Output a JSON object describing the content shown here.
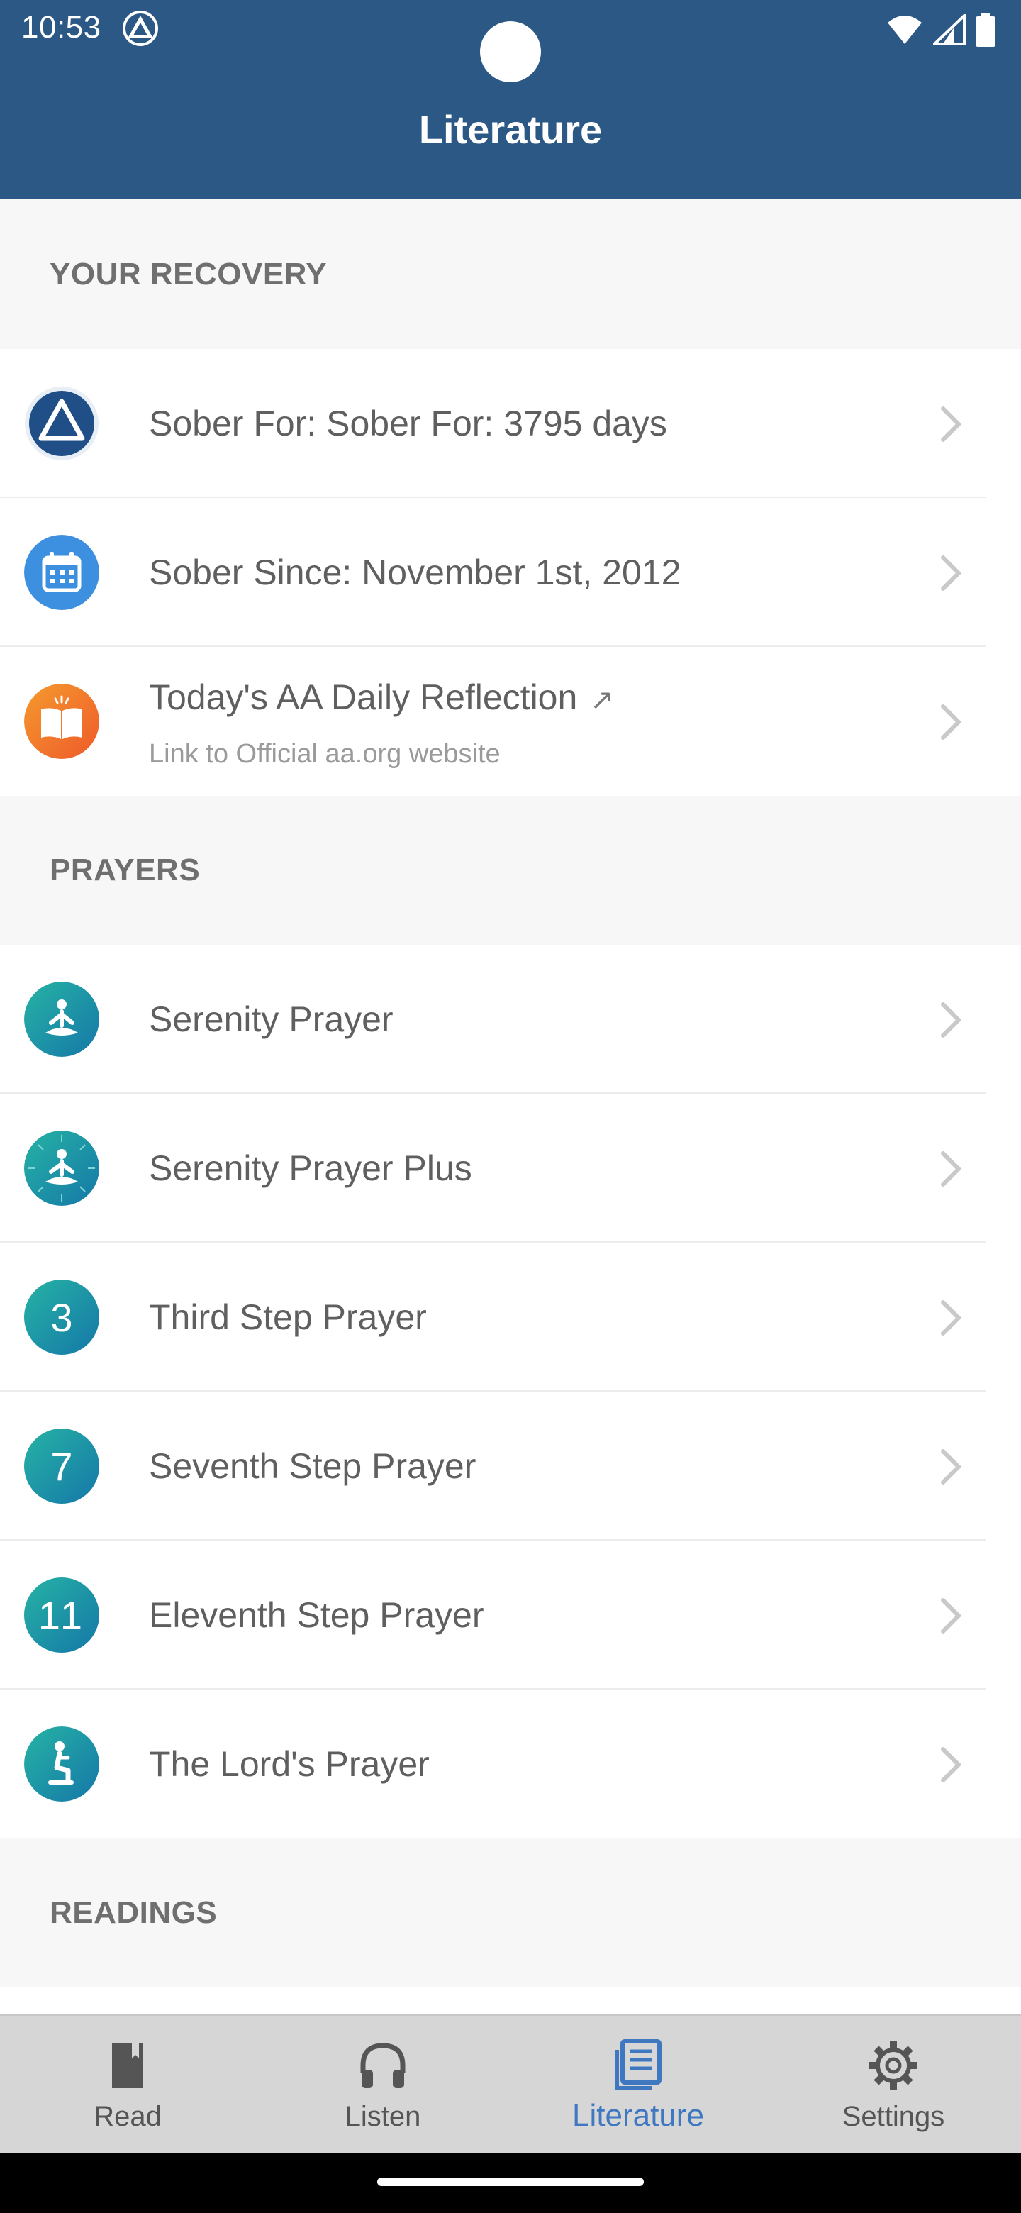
{
  "status_bar": {
    "time": "10:53"
  },
  "app_bar": {
    "title": "Literature"
  },
  "sections": {
    "recovery": {
      "header": "YOUR RECOVERY"
    },
    "prayers": {
      "header": "PRAYERS"
    },
    "readings": {
      "header": "READINGS"
    }
  },
  "recovery_items": [
    {
      "label": "Sober For: Sober For: 3795 days",
      "icon": "aa-triangle-icon"
    },
    {
      "label": "Sober Since: November 1st, 2012",
      "icon": "calendar-icon"
    },
    {
      "label": "Today's AA Daily Reflection",
      "sublabel": "Link to Official aa.org website",
      "external_glyph": "↗",
      "icon": "open-book-icon"
    }
  ],
  "prayer_items": [
    {
      "label": "Serenity Prayer",
      "icon": "meditation-icon"
    },
    {
      "label": "Serenity Prayer Plus",
      "icon": "meditation-rays-icon"
    },
    {
      "label": "Third Step Prayer",
      "icon_text": "3"
    },
    {
      "label": "Seventh Step Prayer",
      "icon_text": "7"
    },
    {
      "label": "Eleventh Step Prayer",
      "icon_text": "11"
    },
    {
      "label": "The Lord's Prayer",
      "icon": "kneeling-prayer-icon"
    }
  ],
  "bottom_nav": {
    "items": [
      {
        "label": "Read",
        "icon": "book-icon"
      },
      {
        "label": "Listen",
        "icon": "headphones-icon"
      },
      {
        "label": "Literature",
        "icon": "literature-icon",
        "active": true
      },
      {
        "label": "Settings",
        "icon": "gear-icon"
      }
    ]
  },
  "colors": {
    "app_bar": "#2c5886",
    "active_nav": "#3f78c1",
    "teal_icon": "#1b9aa3",
    "calendar_blue": "#3d8fe0",
    "book_orange": "#f07a2a"
  }
}
